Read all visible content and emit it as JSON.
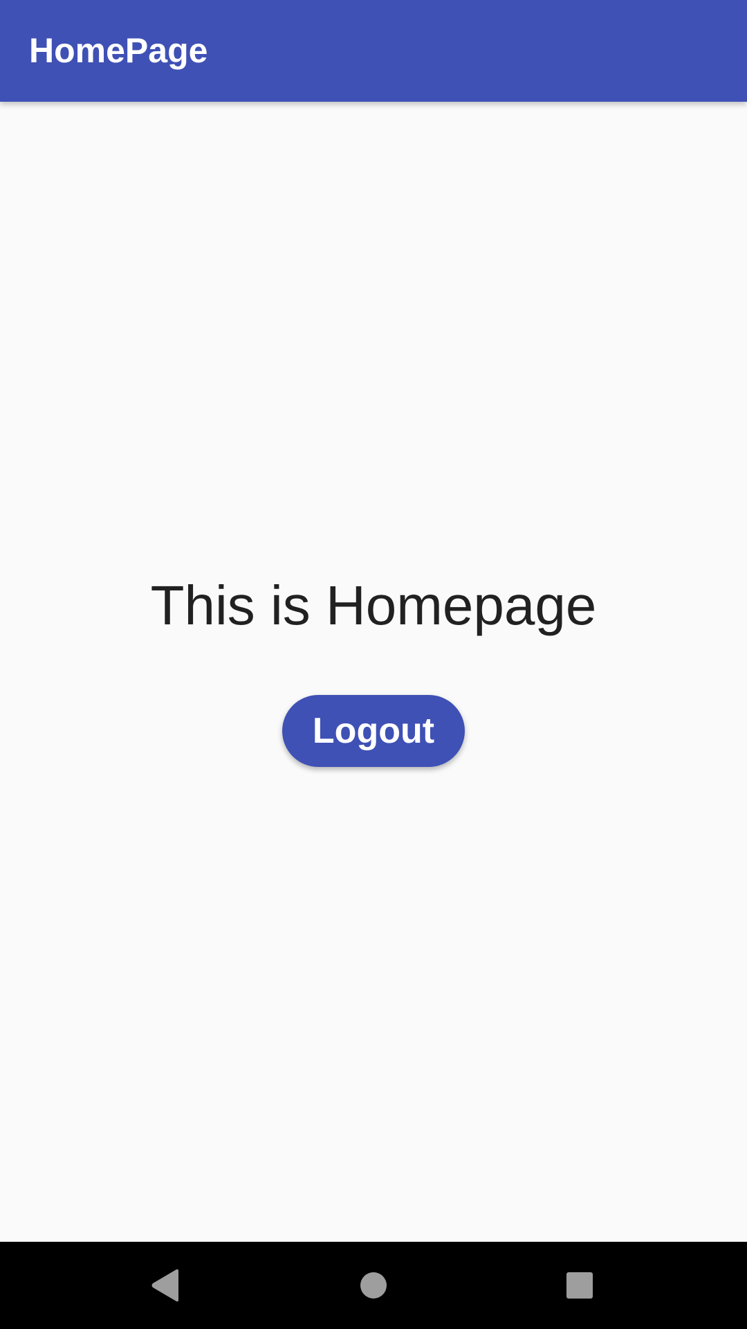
{
  "app_bar": {
    "title": "HomePage",
    "color": "#3f51b5"
  },
  "main": {
    "headline": "This is Homepage",
    "logout_label": "Logout"
  },
  "nav_bar": {
    "buttons": [
      {
        "icon": "back-icon"
      },
      {
        "icon": "home-icon"
      },
      {
        "icon": "recents-icon"
      }
    ]
  }
}
